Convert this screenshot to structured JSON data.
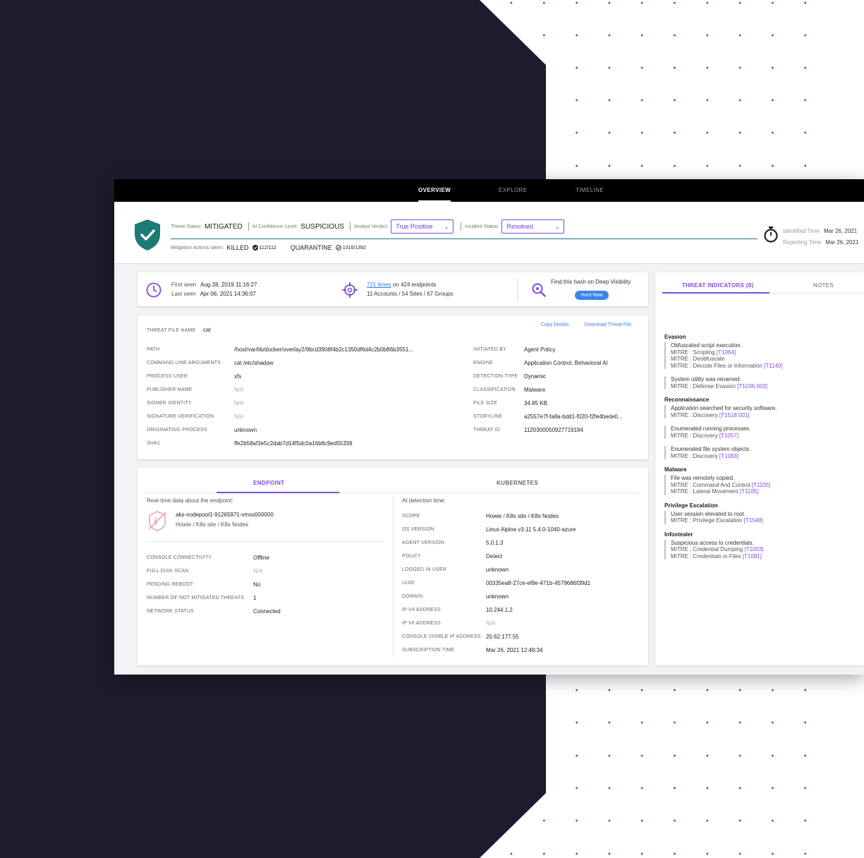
{
  "nav": {
    "tabs": [
      {
        "label": "OVERVIEW"
      },
      {
        "label": "EXPLORE"
      },
      {
        "label": "TIMELINE"
      }
    ]
  },
  "header": {
    "threat_status_label": "Threat Status:",
    "threat_status": "MITIGATED",
    "ai_conf_label": "AI Confidence Level:",
    "ai_conf": "SUSPICIOUS",
    "analyst_label": "Analyst Verdict:",
    "analyst_value": "True Positive",
    "incident_label": "Incident Status:",
    "incident_value": "Resolved",
    "mitigation_label": "Mitigation Actions taken:",
    "killed_label": "KILLED",
    "killed_count": "112/112",
    "quarantine_label": "QUARANTINE",
    "quarantine_count": "1316/1392",
    "identified_label": "Identified Time",
    "identified_value": "Mar 26, 2021",
    "reporting_label": "Reporting Time",
    "reporting_value": "Mar 26, 2021"
  },
  "seen": {
    "first_label": "First seen",
    "first_value": "Aug 28, 2019 11:16:27",
    "last_label": "Last seen",
    "last_value": "Apr 06, 2021 14:36:07",
    "times_link": "721 times",
    "times_on": "on",
    "endpoints": "424 endpoints",
    "scope": "11 Accounts / 54 Sites / 67 Groups",
    "dv_text": "Find this hash on Deep Visibility",
    "hunt_label": "Hunt Now"
  },
  "file": {
    "title_label": "THREAT FILE NAME",
    "title_value": "cat",
    "copy_label": "Copy Details",
    "download_label": "Download Threat File",
    "left": [
      {
        "label": "PATH",
        "value": "/host/var/lib/docker/overlay2/9bcd3908f4b2c1350df6d4c2b0b86b3551..."
      },
      {
        "label": "COMMAND LINE ARGUMENTS",
        "value": "cat /etc/shadow"
      },
      {
        "label": "PROCESS USER",
        "value": "xfs"
      },
      {
        "label": "PUBLISHER NAME",
        "value": "N/A"
      },
      {
        "label": "SIGNER IDENTITY",
        "value": "N/A"
      },
      {
        "label": "SIGNATURE VERIFICATION",
        "value": "N/A"
      },
      {
        "label": "ORIGINATING PROCESS",
        "value": "unknown"
      },
      {
        "label": "SHA1",
        "value": "ffe2b58af3e5c2dab7d14f5dc0a16b8c9ed55339"
      }
    ],
    "right": [
      {
        "label": "INITIATED BY",
        "value": "Agent Policy"
      },
      {
        "label": "ENGINE",
        "value": "Application Control, Behavioral AI"
      },
      {
        "label": "DETECTION TYPE",
        "value": "Dynamic"
      },
      {
        "label": "CLASSIFICATION",
        "value": "Malware"
      },
      {
        "label": "FILE SIZE",
        "value": "34.85 KB"
      },
      {
        "label": "STORYLINE",
        "value": "a2557e7f-fa8a-bdd1-f020-f2fe4bede0..."
      },
      {
        "label": "THREAT ID",
        "value": "1120300050927719184"
      }
    ]
  },
  "endpoint": {
    "tabs": [
      "ENDPOINT",
      "KUBERNETES"
    ],
    "realtime_label": "Real-time data about the endpoint:",
    "node_name": "aks-nodepool1-91265971-vmss000000",
    "node_sub": "Howie / K8s site / K8s Nodes",
    "left": [
      {
        "label": "CONSOLE CONNECTIVITY",
        "value": "Offline"
      },
      {
        "label": "FULL DISK SCAN",
        "value": "N/A"
      },
      {
        "label": "PENDING REBOOT",
        "value": "No"
      },
      {
        "label": "NUMBER OF NOT MITIGATED THREATS",
        "value": "1"
      },
      {
        "label": "NETWORK STATUS",
        "value": "Connected"
      }
    ],
    "detection_label": "At detection time:",
    "right": [
      {
        "label": "SCOPE",
        "value": "Howie / K8s site / K8s Nodes"
      },
      {
        "label": "OS VERSION",
        "value": "Linux Alpine v3.11 5.4.0-1040-azure"
      },
      {
        "label": "AGENT VERSION",
        "value": "5.0.1.3"
      },
      {
        "label": "POLICY",
        "value": "Detect"
      },
      {
        "label": "LOGGED IN USER",
        "value": "unknown"
      },
      {
        "label": "UUID",
        "value": "00335ea8-27ce-ef8e-471b-4579686f39d1"
      },
      {
        "label": "DOMAIN",
        "value": "unknown"
      },
      {
        "label": "IP V4 ADDRESS",
        "value": "10.244.1.2"
      },
      {
        "label": "IP V6 ADDRESS",
        "value": "N/A"
      },
      {
        "label": "CONSOLE VISIBLE IP ADDRESS",
        "value": "20.62.177.55"
      },
      {
        "label": "SUBSCRIPTION TIME",
        "value": "Mar 26, 2021 12:48:34"
      }
    ]
  },
  "threat_panel": {
    "tabs": [
      "THREAT INDICATORS (8)",
      "NOTES"
    ],
    "categories": [
      {
        "name": "Evasion",
        "items": [
          {
            "title": "Obfuscated script execution.",
            "lines": [
              {
                "text": "MITRE : Scripting ",
                "tid": "[T1064]"
              },
              {
                "text": "MITRE : Deobfuscate",
                "tid": ""
              },
              {
                "text": "MITRE : Decode Files or Information ",
                "tid": "[T1140]"
              }
            ]
          },
          {
            "title": "System utility was renamed.",
            "lines": [
              {
                "text": "MITRE : Defense Evasion ",
                "tid": "[T1036.003]"
              }
            ]
          }
        ]
      },
      {
        "name": "Reconnaissance",
        "items": [
          {
            "title": "Application searched for security software.",
            "lines": [
              {
                "text": "MITRE : Discovery ",
                "tid": "[T1518.001]"
              }
            ]
          },
          {
            "title": "Enumerated running processes.",
            "lines": [
              {
                "text": "MITRE : Discovery ",
                "tid": "[T1057]"
              }
            ]
          },
          {
            "title": "Enumerated file system objects.",
            "lines": [
              {
                "text": "MITRE : Discovery ",
                "tid": "[T1083]"
              }
            ]
          }
        ]
      },
      {
        "name": "Malware",
        "items": [
          {
            "title": "File was remotely copied.",
            "lines": [
              {
                "text": "MITRE : Command And Control ",
                "tid": "[T1105]"
              },
              {
                "text": "MITRE : Lateral Movement ",
                "tid": "[T1105]"
              }
            ]
          }
        ]
      },
      {
        "name": "Privilege Escalation",
        "items": [
          {
            "title": "User session elevated to root.",
            "lines": [
              {
                "text": "MITRE : Privilege Escalation ",
                "tid": "[T1548]"
              }
            ]
          }
        ]
      },
      {
        "name": "Infostealer",
        "items": [
          {
            "title": "Suspicious access to credentials.",
            "lines": [
              {
                "text": "MITRE : Credential Dumping ",
                "tid": "[T1003]"
              },
              {
                "text": "MITRE : Credentials in Files ",
                "tid": "[T1081]"
              }
            ]
          }
        ]
      }
    ]
  },
  "colors": {
    "accent": "#7b4ce0",
    "shield": "#1e7a74",
    "highlight_box": "#6b9a3a",
    "background_dark": "#1c1c2e",
    "dot": "#7a2be0"
  }
}
